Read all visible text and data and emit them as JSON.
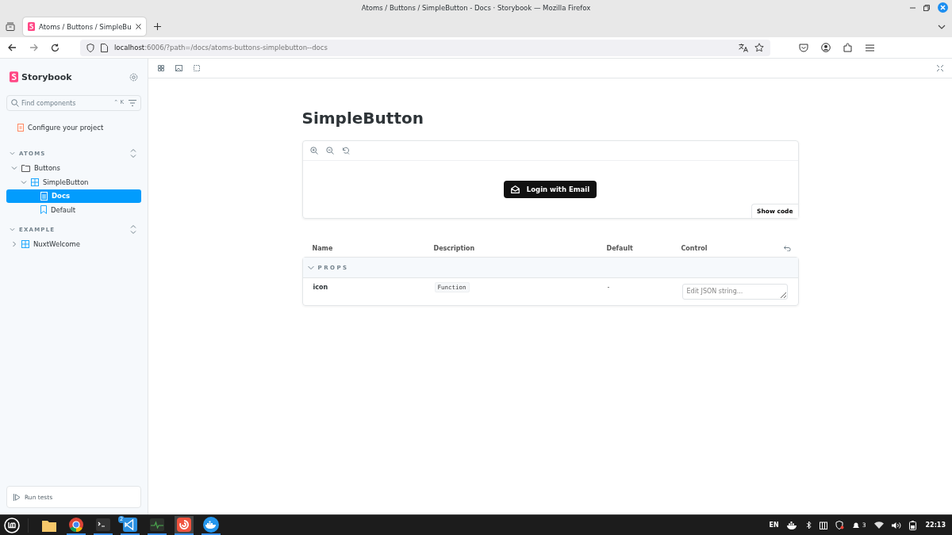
{
  "window": {
    "title": "Atoms / Buttons / SimpleButton - Docs · Storybook — Mozilla Firefox"
  },
  "browser": {
    "tabs": [
      {
        "title": "Atoms / Buttons / SimpleBu",
        "selected": true
      }
    ],
    "url": {
      "host": "localhost",
      "rest": ":6006/?path=/docs/atoms-buttons-simplebutton--docs"
    }
  },
  "sidebar": {
    "brand": "Storybook",
    "search": {
      "placeholder": "Find components",
      "shortcut": "⌃ K"
    },
    "configure": "Configure your project",
    "groups": [
      {
        "label": "ATOMS",
        "items": [
          {
            "label": "Buttons",
            "kind": "folder",
            "expanded": true,
            "selected": false,
            "children": [
              {
                "label": "SimpleButton",
                "kind": "component",
                "expanded": true,
                "selected": false,
                "children": [
                  {
                    "label": "Docs",
                    "kind": "docs",
                    "selected": true
                  },
                  {
                    "label": "Default",
                    "kind": "story",
                    "selected": false
                  }
                ]
              }
            ]
          }
        ]
      },
      {
        "label": "EXAMPLE",
        "items": [
          {
            "label": "NuxtWelcome",
            "kind": "component",
            "expanded": false,
            "selected": false
          }
        ]
      }
    ],
    "run_tests": "Run tests"
  },
  "docs": {
    "title": "SimpleButton",
    "preview_button": "Login with Email",
    "show_code": "Show code",
    "table": {
      "columns": [
        "Name",
        "Description",
        "Default",
        "Control"
      ],
      "section": "PROPS",
      "rows": [
        {
          "name": "icon",
          "type": "Function",
          "default": "-",
          "control_placeholder": "Edit JSON string..."
        }
      ]
    }
  },
  "taskbar": {
    "apps": [
      {
        "kind": "files",
        "running": false,
        "selected": false
      },
      {
        "kind": "chrome",
        "running": true,
        "selected": false
      },
      {
        "kind": "terminal",
        "running": true,
        "selected": false
      },
      {
        "kind": "vscode",
        "running": true,
        "selected": false,
        "badge": "2"
      },
      {
        "kind": "monitor",
        "running": true,
        "selected": false
      },
      {
        "kind": "firefox",
        "running": true,
        "selected": true
      },
      {
        "kind": "docker",
        "running": true,
        "selected": false
      }
    ],
    "tray": {
      "language": "EN",
      "notifications": "3",
      "clock": "22:13"
    }
  }
}
